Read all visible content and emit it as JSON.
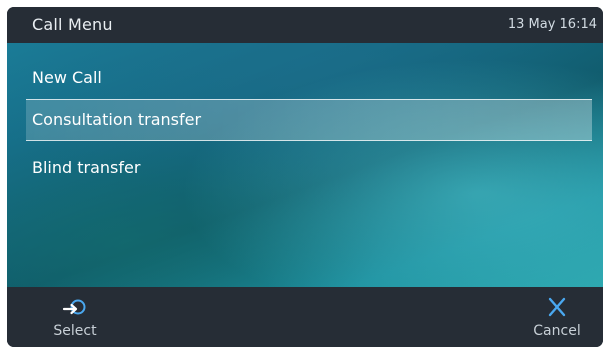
{
  "header": {
    "title": "Call Menu",
    "datetime": "13 May 16:14"
  },
  "menu": {
    "items": [
      {
        "label": "New Call",
        "selected": false
      },
      {
        "label": "Consultation transfer",
        "selected": true
      },
      {
        "label": "Blind transfer",
        "selected": false
      }
    ]
  },
  "softkeys": {
    "left": {
      "label": "Select",
      "icon": "select-arrow-icon"
    },
    "right": {
      "label": "Cancel",
      "icon": "close-x-icon"
    }
  },
  "colors": {
    "accent": "#4aa8f0",
    "bar": "#262d36"
  }
}
